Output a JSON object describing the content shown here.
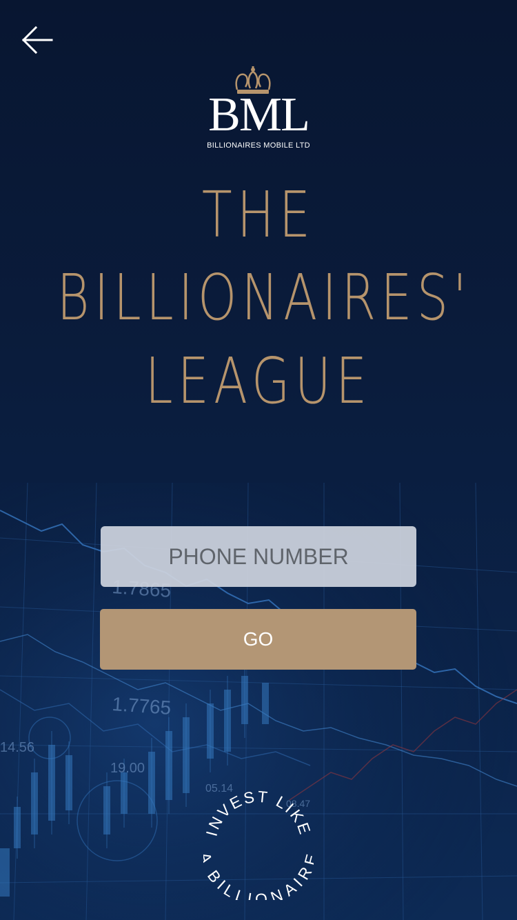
{
  "brand": {
    "monogram": "BML",
    "name": "BILLIONAIRES MOBILE LTD"
  },
  "hero": {
    "line1": "THE",
    "line2": "BILLIONAIRES'",
    "line3": "LEAGUE"
  },
  "form": {
    "phone_placeholder": "PHONE NUMBER",
    "phone_value": "",
    "go_label": "GO"
  },
  "tagline": {
    "top": "INVEST LIKE",
    "bottom": "A BILLIONAIRE"
  },
  "background_chart": {
    "labels": [
      "1.7865",
      "1.7765",
      "14.56",
      "19.00",
      "05.14",
      "08.47"
    ]
  },
  "colors": {
    "background": "#0a1c3c",
    "accent_gold": "#b6946c",
    "button_gold": "#b39675",
    "input_bg": "#cdd3de"
  },
  "icons": {
    "back": "arrow-left-icon",
    "crown": "crown-icon"
  }
}
